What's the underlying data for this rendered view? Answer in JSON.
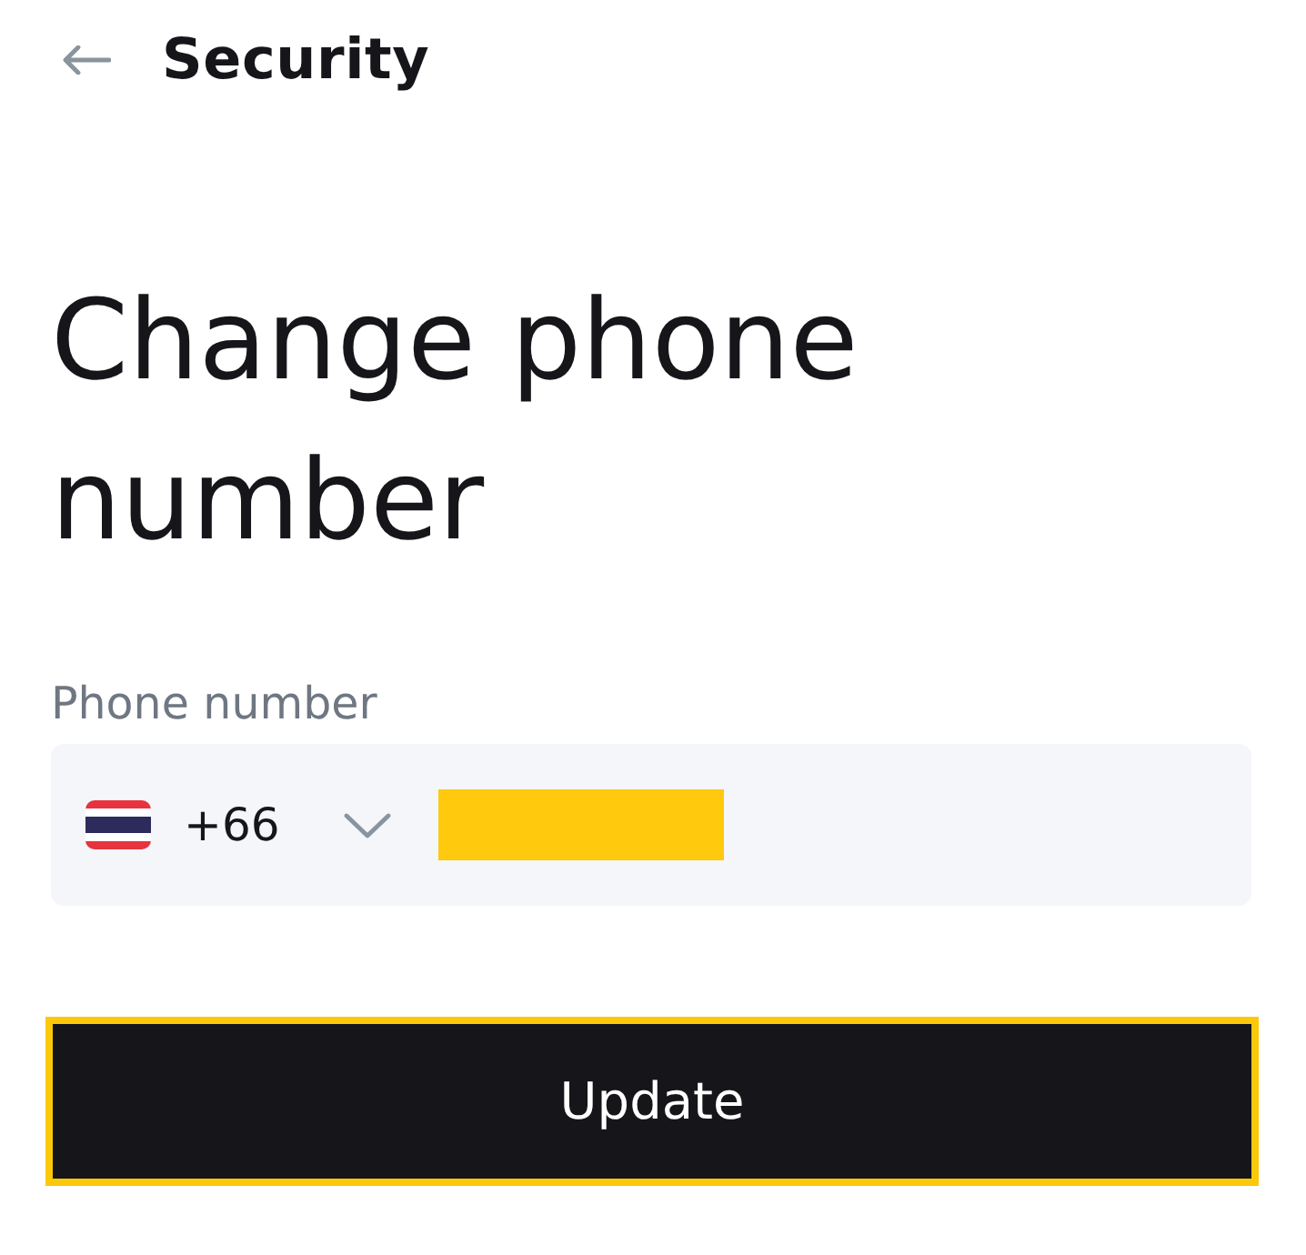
{
  "header": {
    "title": "Security"
  },
  "heading": "Change phone number",
  "phone_field": {
    "label": "Phone number",
    "country_code": "+66",
    "value_redacted": true
  },
  "button": {
    "label": "Update",
    "focused": true
  }
}
